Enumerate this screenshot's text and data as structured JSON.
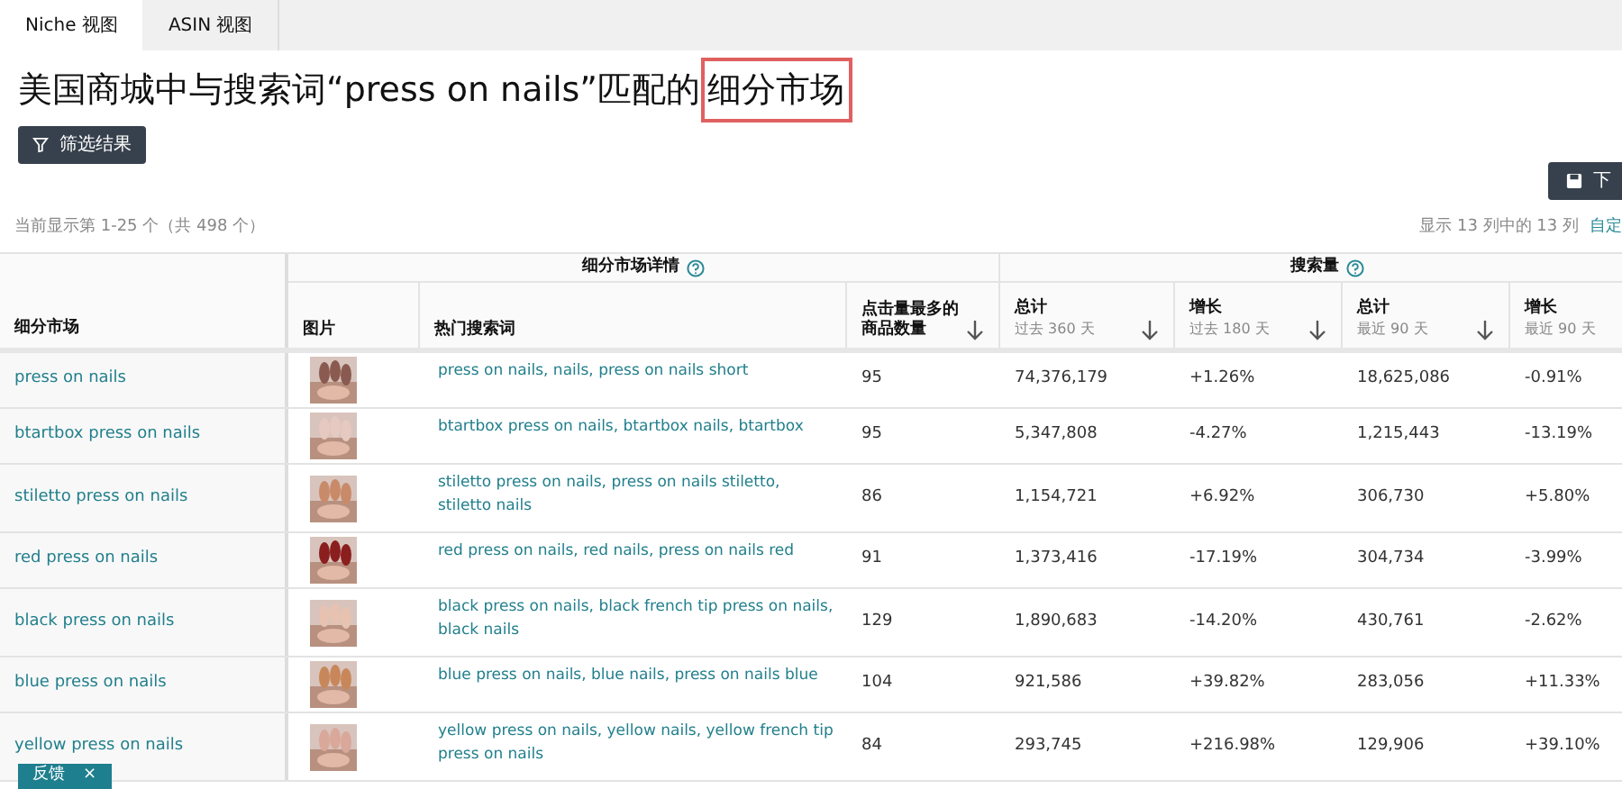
{
  "tabs": [
    {
      "label": "Niche 视图",
      "selected": true
    },
    {
      "label": "ASIN 视图",
      "selected": false
    }
  ],
  "title": "美国商城中与搜索词“press on nails”匹配的",
  "title_highlight": "细分市场",
  "filter_button": "筛选结果",
  "download_button": "下",
  "showing": "当前显示第 1-25 个（共 498 个）",
  "columns_info": "显示 13 列中的 13 列",
  "customize_link": "自定",
  "groups": [
    {
      "label": "细分市场详情"
    },
    {
      "label": "搜索量"
    }
  ],
  "columns": [
    {
      "label": "细分市场"
    },
    {
      "label": "图片"
    },
    {
      "label": "热门搜索词"
    },
    {
      "label": "点击量最多的商品数量",
      "sortable": true
    },
    {
      "label": "总计",
      "sub": "过去 360 天",
      "sortable": true
    },
    {
      "label": "增长",
      "sub": "过去 180 天",
      "sortable": true
    },
    {
      "label": "总计",
      "sub": "最近 90 天",
      "sortable": true
    },
    {
      "label": "增长",
      "sub": "最近 90 天"
    }
  ],
  "rows": [
    {
      "niche": "press on nails",
      "keywords": "press on nails, nails, press on nails short",
      "count": "95",
      "total_360": "74,376,179",
      "growth_180": "+1.26%",
      "total_90": "18,625,086",
      "growth_90": "-0.91%"
    },
    {
      "niche": "btartbox press on nails",
      "keywords": "btartbox press on nails, btartbox nails, btartbox",
      "count": "95",
      "total_360": "5,347,808",
      "growth_180": "-4.27%",
      "total_90": "1,215,443",
      "growth_90": "-13.19%"
    },
    {
      "niche": "stiletto press on nails",
      "keywords": "stiletto press on nails, press on nails stiletto, stiletto nails",
      "count": "86",
      "total_360": "1,154,721",
      "growth_180": "+6.92%",
      "total_90": "306,730",
      "growth_90": "+5.80%"
    },
    {
      "niche": "red press on nails",
      "keywords": "red press on nails, red nails, press on nails red",
      "count": "91",
      "total_360": "1,373,416",
      "growth_180": "-17.19%",
      "total_90": "304,734",
      "growth_90": "-3.99%"
    },
    {
      "niche": "black press on nails",
      "keywords": "black press on nails, black french tip press on nails, black nails",
      "count": "129",
      "total_360": "1,890,683",
      "growth_180": "-14.20%",
      "total_90": "430,761",
      "growth_90": "-2.62%"
    },
    {
      "niche": "blue press on nails",
      "keywords": "blue press on nails, blue nails, press on nails blue",
      "count": "104",
      "total_360": "921,586",
      "growth_180": "+39.82%",
      "total_90": "283,056",
      "growth_90": "+11.33%"
    },
    {
      "niche": "yellow press on nails",
      "keywords": "yellow press on nails, yellow nails, yellow french tip press on nails",
      "count": "84",
      "total_360": "293,745",
      "growth_180": "+216.98%",
      "total_90": "129,906",
      "growth_90": "+39.10%"
    }
  ],
  "feedback": {
    "label": "反馈",
    "close": "×"
  }
}
